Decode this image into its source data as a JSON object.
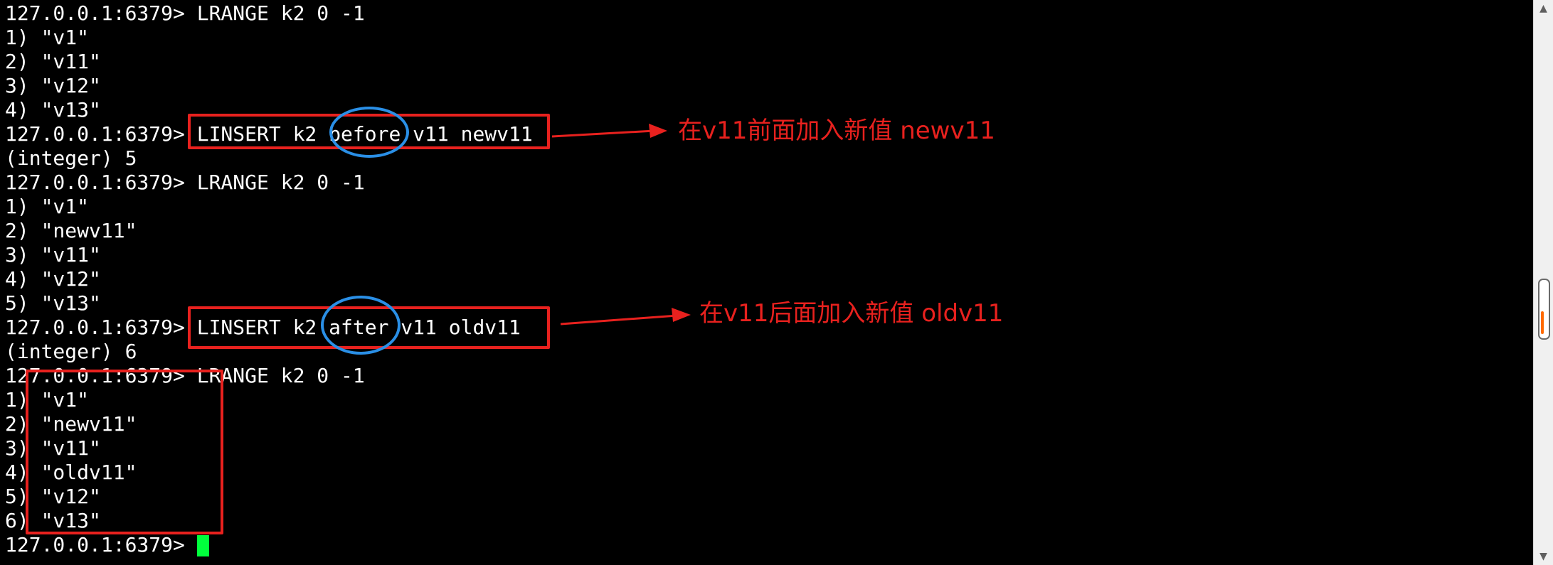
{
  "terminal": {
    "lines": [
      "127.0.0.1:6379> LRANGE k2 0 -1",
      "1) \"v1\"",
      "2) \"v11\"",
      "3) \"v12\"",
      "4) \"v13\"",
      "127.0.0.1:6379> LINSERT k2 before v11 newv11",
      "(integer) 5",
      "127.0.0.1:6379> LRANGE k2 0 -1",
      "1) \"v1\"",
      "2) \"newv11\"",
      "3) \"v11\"",
      "4) \"v12\"",
      "5) \"v13\"",
      "127.0.0.1:6379> LINSERT k2 after v11 oldv11",
      "(integer) 6",
      "127.0.0.1:6379> LRANGE k2 0 -1",
      "1) \"v1\"",
      "2) \"newv11\"",
      "3) \"v11\"",
      "4) \"oldv11\"",
      "5) \"v12\"",
      "6) \"v13\""
    ],
    "prompt": "127.0.0.1:6379>",
    "cursor_color": "#00ff3c",
    "text_color": "#ffffff",
    "background": "#000000"
  },
  "annotations": {
    "before_note": "在v11前面加入新值 newv11",
    "after_note": "在v11后面加入新值 oldv11",
    "note_color": "#e8211e",
    "box_color": "#e8211e",
    "ellipse_color": "#2a8fe6"
  },
  "scrollbar": {
    "up_arrow": "▲",
    "down_arrow": "▼",
    "marker_color": "#ff6a00"
  }
}
